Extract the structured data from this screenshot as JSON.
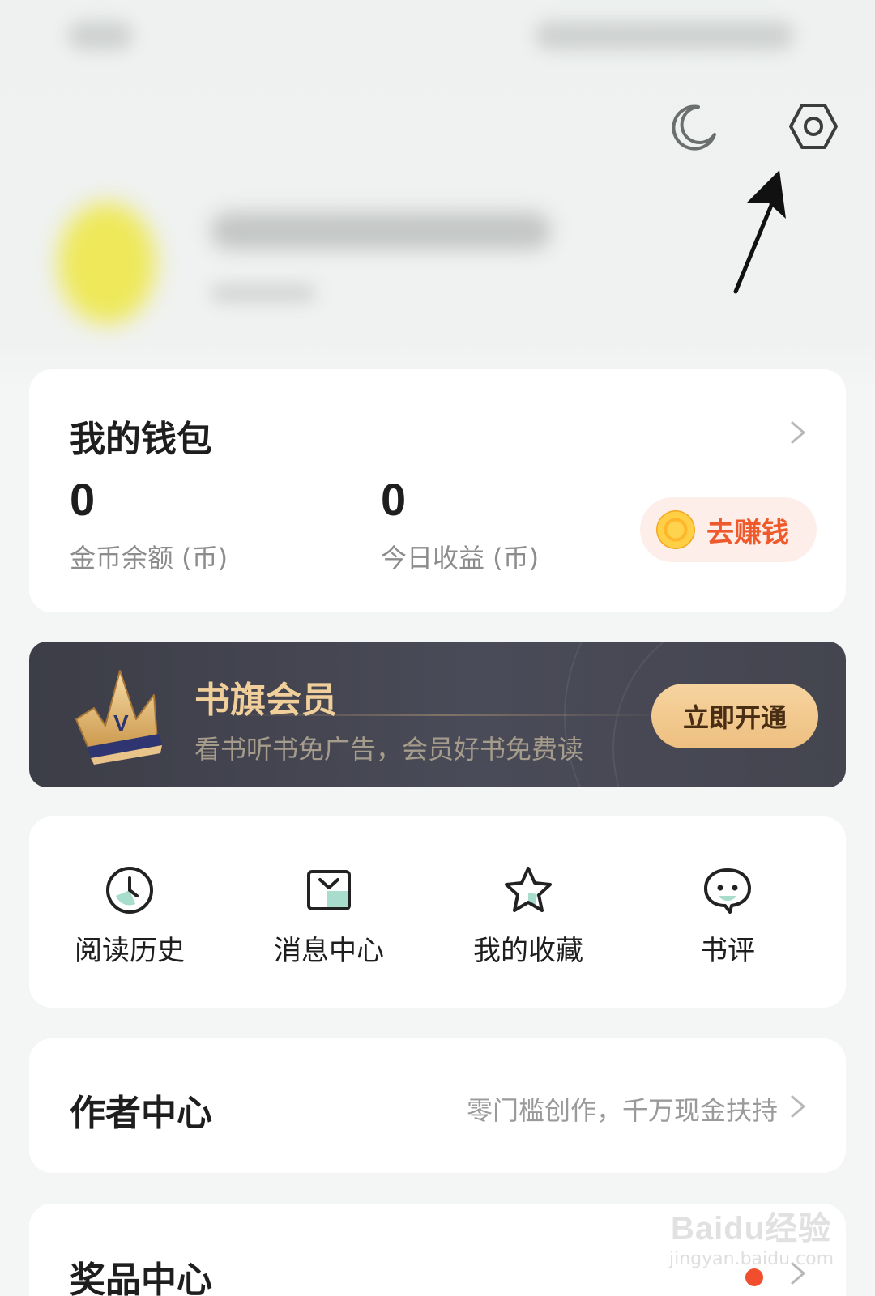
{
  "topbar": {
    "moon_icon": "moon-icon",
    "settings_icon": "settings-hexagon-icon"
  },
  "wallet": {
    "title": "我的钱包",
    "coin_balance_value": "0",
    "coin_balance_label": "金币余额 (币)",
    "today_earnings_value": "0",
    "today_earnings_label": "今日收益 (币)",
    "earn_button": "去赚钱"
  },
  "vip": {
    "title": "书旗会员",
    "description": "看书听书免广告，会员好书免费读",
    "button": "立即开通"
  },
  "shortcuts": [
    {
      "label": "阅读历史",
      "icon": "clock-icon"
    },
    {
      "label": "消息中心",
      "icon": "message-box-icon"
    },
    {
      "label": "我的收藏",
      "icon": "star-icon"
    },
    {
      "label": "书评",
      "icon": "chat-bubble-icon"
    }
  ],
  "author_center": {
    "title": "作者中心",
    "subtitle": "零门槛创作，千万现金扶持"
  },
  "prize_center": {
    "title": "奖品中心"
  },
  "watermark": {
    "text": "Baidu经验",
    "sub": "jingyan.baidu.com"
  },
  "colors": {
    "accent_orange": "#ee5a2b",
    "vip_gold": "#f1cf9a",
    "vip_bg": "#44454f",
    "icon_mint": "#a8dccc"
  }
}
